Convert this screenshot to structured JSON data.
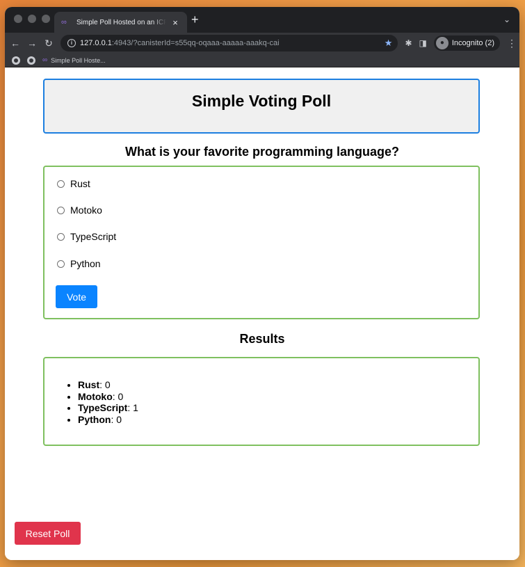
{
  "browser": {
    "tab": {
      "title": "Simple Poll Hosted on an ICP c"
    },
    "url": {
      "host": "127.0.0.1",
      "rest": ":4943/?canisterId=s55qq-oqaaa-aaaaa-aaakq-cai"
    },
    "incognito_label": "Incognito (2)",
    "bookmarks": [
      {
        "label": "Simple Poll Hoste..."
      }
    ],
    "icons": [
      "back-icon",
      "forward-icon",
      "reload-icon",
      "info-icon",
      "star-icon",
      "extensions-icon",
      "sidepanel-icon",
      "incognito-icon",
      "menu-icon"
    ]
  },
  "page": {
    "title": "Simple Voting Poll",
    "question": "What is your favorite programming language?",
    "options": [
      {
        "label": "Rust"
      },
      {
        "label": "Motoko"
      },
      {
        "label": "TypeScript"
      },
      {
        "label": "Python"
      }
    ],
    "vote_label": "Vote",
    "results_title": "Results",
    "results": [
      {
        "name": "Rust",
        "count": ": 0"
      },
      {
        "name": "Motoko",
        "count": ": 0"
      },
      {
        "name": "TypeScript",
        "count": ": 1"
      },
      {
        "name": "Python",
        "count": ": 0"
      }
    ],
    "reset_label": "Reset Poll"
  },
  "colors": {
    "header_border": "#1d7fe0",
    "box_border": "#7fc05f",
    "vote_button": "#0a84ff",
    "reset_button": "#e0344c"
  }
}
